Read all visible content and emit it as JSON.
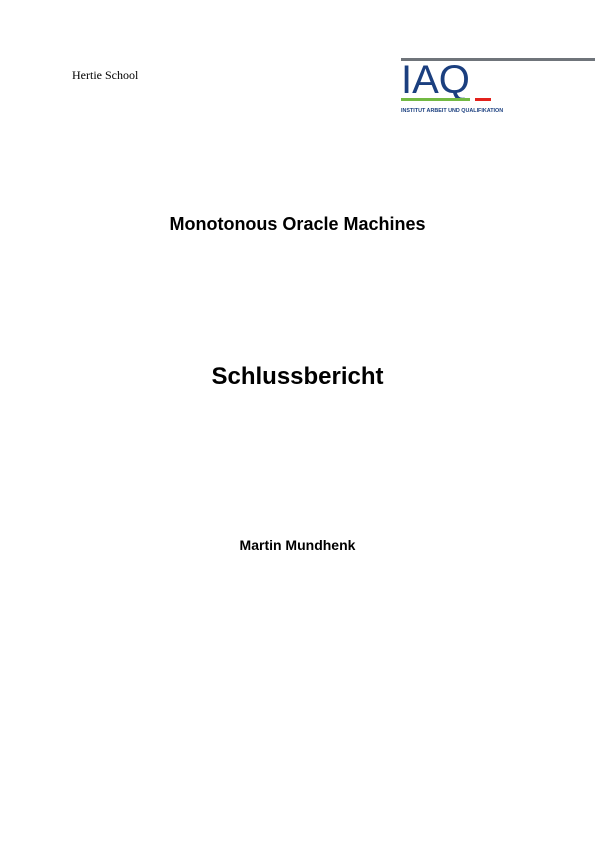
{
  "institution": "Hertie School",
  "logo": {
    "letters": "IAQ",
    "subtitle": "INSTITUT ARBEIT UND QUALIFIKATION",
    "colors": {
      "blue": "#1b3f7f",
      "green": "#72b943",
      "red": "#e3211c",
      "gray": "#6f747a"
    }
  },
  "project_title": "Monotonous Oracle Machines",
  "report_type": "Schlussbericht",
  "author": "Martin Mundhenk"
}
